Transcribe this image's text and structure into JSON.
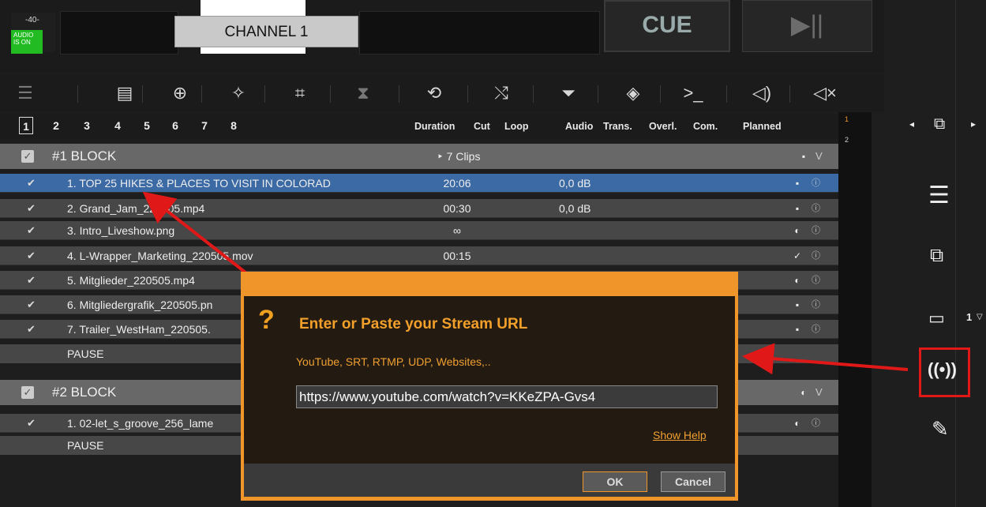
{
  "header": {
    "audio_level": "-40-",
    "audio_status": "AUDIO IS ON",
    "channel": "CHANNEL 1",
    "cue": "CUE",
    "play_pause": "▶||"
  },
  "pages": [
    "1",
    "2",
    "3",
    "4",
    "5",
    "6",
    "7",
    "8"
  ],
  "columns": {
    "duration": "Duration",
    "cut": "Cut",
    "loop": "Loop",
    "audio": "Audio",
    "trans": "Trans.",
    "overl": "Overl.",
    "com": "Com.",
    "planned": "Planned"
  },
  "blocks": [
    {
      "title": "#1  BLOCK",
      "clips": "‣ 7 Clips",
      "items": [
        {
          "name": "1. TOP 25 HIKES & PLACES TO VISIT IN COLORAD",
          "duration": "20:06",
          "audio": "0,0 dB",
          "planned": "▪"
        },
        {
          "name": "2. Grand_Jam_220505.mp4",
          "duration": "00:30",
          "audio": "0,0 dB",
          "planned": "▪"
        },
        {
          "name": "3. Intro_Liveshow.png",
          "duration": "∞",
          "audio": "",
          "planned": "◐"
        },
        {
          "name": "4. L-Wrapper_Marketing_220505.mov",
          "duration": "00:15",
          "audio": "",
          "planned": "✓"
        },
        {
          "name": "5. Mitglieder_220505.mp4",
          "duration": "",
          "audio": "",
          "planned": "◐"
        },
        {
          "name": "6. Mitgliedergrafik_220505.pn",
          "duration": "",
          "audio": "",
          "planned": "▪"
        },
        {
          "name": "7. Trailer_WestHam_220505.",
          "duration": "",
          "audio": "",
          "planned": "▪"
        }
      ],
      "pause": "PAUSE"
    },
    {
      "title": "#2  BLOCK",
      "items": [
        {
          "name": "1. 02-let_s_groove_256_lame",
          "planned": "◐"
        }
      ],
      "pause": "PAUSE"
    }
  ],
  "right_numbers": [
    "1",
    "2"
  ],
  "sidebar": {
    "camera_count": "1"
  },
  "dialog": {
    "title": "Enter or Paste your Stream URL",
    "subtitle": "YouTube, SRT, RTMP, UDP, Websites,..",
    "url": "https://www.youtube.com/watch?v=KKeZPA-Gvs4",
    "help": "Show Help",
    "ok": "OK",
    "cancel": "Cancel"
  },
  "colors": {
    "accent_orange": "#f0952a",
    "selection_blue": "#3c6aa5",
    "annotation_red": "#e01818"
  }
}
